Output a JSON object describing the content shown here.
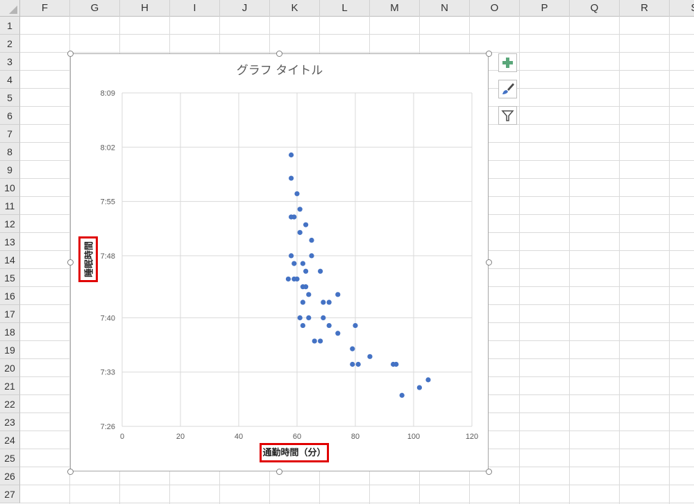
{
  "columns": [
    "F",
    "G",
    "H",
    "I",
    "J",
    "K",
    "L",
    "M",
    "N",
    "O",
    "P",
    "Q",
    "R",
    "S"
  ],
  "rows": [
    "1",
    "2",
    "3",
    "4",
    "5",
    "6",
    "7",
    "8",
    "9",
    "10",
    "11",
    "12",
    "13",
    "14",
    "15",
    "16",
    "17",
    "18",
    "19",
    "20",
    "21",
    "22",
    "23",
    "24",
    "25",
    "26",
    "27"
  ],
  "chart_tools": [
    {
      "name": "chart-elements-button",
      "icon": "plus-icon"
    },
    {
      "name": "chart-styles-button",
      "icon": "brush-icon"
    },
    {
      "name": "chart-filters-button",
      "icon": "filter-icon"
    }
  ],
  "colors": {
    "marker": "#4472c4",
    "gridline": "#d9d9d9",
    "highlight": "#e00000",
    "title": "#595959"
  },
  "chart_data": {
    "type": "scatter",
    "title": "グラフ タイトル",
    "xlabel": "通勤時間（分）",
    "ylabel": "睡眠時間",
    "xlim": [
      0,
      120
    ],
    "x_ticks": [
      "0",
      "20",
      "40",
      "60",
      "80",
      "100",
      "120"
    ],
    "y_ticks": [
      "7:26",
      "7:33",
      "7:40",
      "7:48",
      "7:55",
      "8:02",
      "8:09"
    ],
    "ylim": [
      "7:26",
      "8:09"
    ],
    "grid": true,
    "series": [
      {
        "points": [
          {
            "x": 58,
            "y": "8:01"
          },
          {
            "x": 58,
            "y": "7:58"
          },
          {
            "x": 60,
            "y": "7:56"
          },
          {
            "x": 61,
            "y": "7:54"
          },
          {
            "x": 58,
            "y": "7:53"
          },
          {
            "x": 59,
            "y": "7:53"
          },
          {
            "x": 63,
            "y": "7:52"
          },
          {
            "x": 61,
            "y": "7:51"
          },
          {
            "x": 65,
            "y": "7:50"
          },
          {
            "x": 58,
            "y": "7:48"
          },
          {
            "x": 65,
            "y": "7:48"
          },
          {
            "x": 59,
            "y": "7:47"
          },
          {
            "x": 62,
            "y": "7:47"
          },
          {
            "x": 63,
            "y": "7:46"
          },
          {
            "x": 68,
            "y": "7:46"
          },
          {
            "x": 57,
            "y": "7:45"
          },
          {
            "x": 59,
            "y": "7:45"
          },
          {
            "x": 60,
            "y": "7:45"
          },
          {
            "x": 62,
            "y": "7:44"
          },
          {
            "x": 63,
            "y": "7:44"
          },
          {
            "x": 64,
            "y": "7:43"
          },
          {
            "x": 74,
            "y": "7:43"
          },
          {
            "x": 62,
            "y": "7:42"
          },
          {
            "x": 69,
            "y": "7:42"
          },
          {
            "x": 71,
            "y": "7:42"
          },
          {
            "x": 61,
            "y": "7:40"
          },
          {
            "x": 64,
            "y": "7:40"
          },
          {
            "x": 69,
            "y": "7:40"
          },
          {
            "x": 62,
            "y": "7:39"
          },
          {
            "x": 71,
            "y": "7:39"
          },
          {
            "x": 80,
            "y": "7:39"
          },
          {
            "x": 74,
            "y": "7:38"
          },
          {
            "x": 66,
            "y": "7:37"
          },
          {
            "x": 68,
            "y": "7:37"
          },
          {
            "x": 79,
            "y": "7:36"
          },
          {
            "x": 85,
            "y": "7:35"
          },
          {
            "x": 79,
            "y": "7:34"
          },
          {
            "x": 81,
            "y": "7:34"
          },
          {
            "x": 93,
            "y": "7:34"
          },
          {
            "x": 94,
            "y": "7:34"
          },
          {
            "x": 105,
            "y": "7:32"
          },
          {
            "x": 102,
            "y": "7:31"
          },
          {
            "x": 96,
            "y": "7:30"
          }
        ]
      }
    ]
  }
}
